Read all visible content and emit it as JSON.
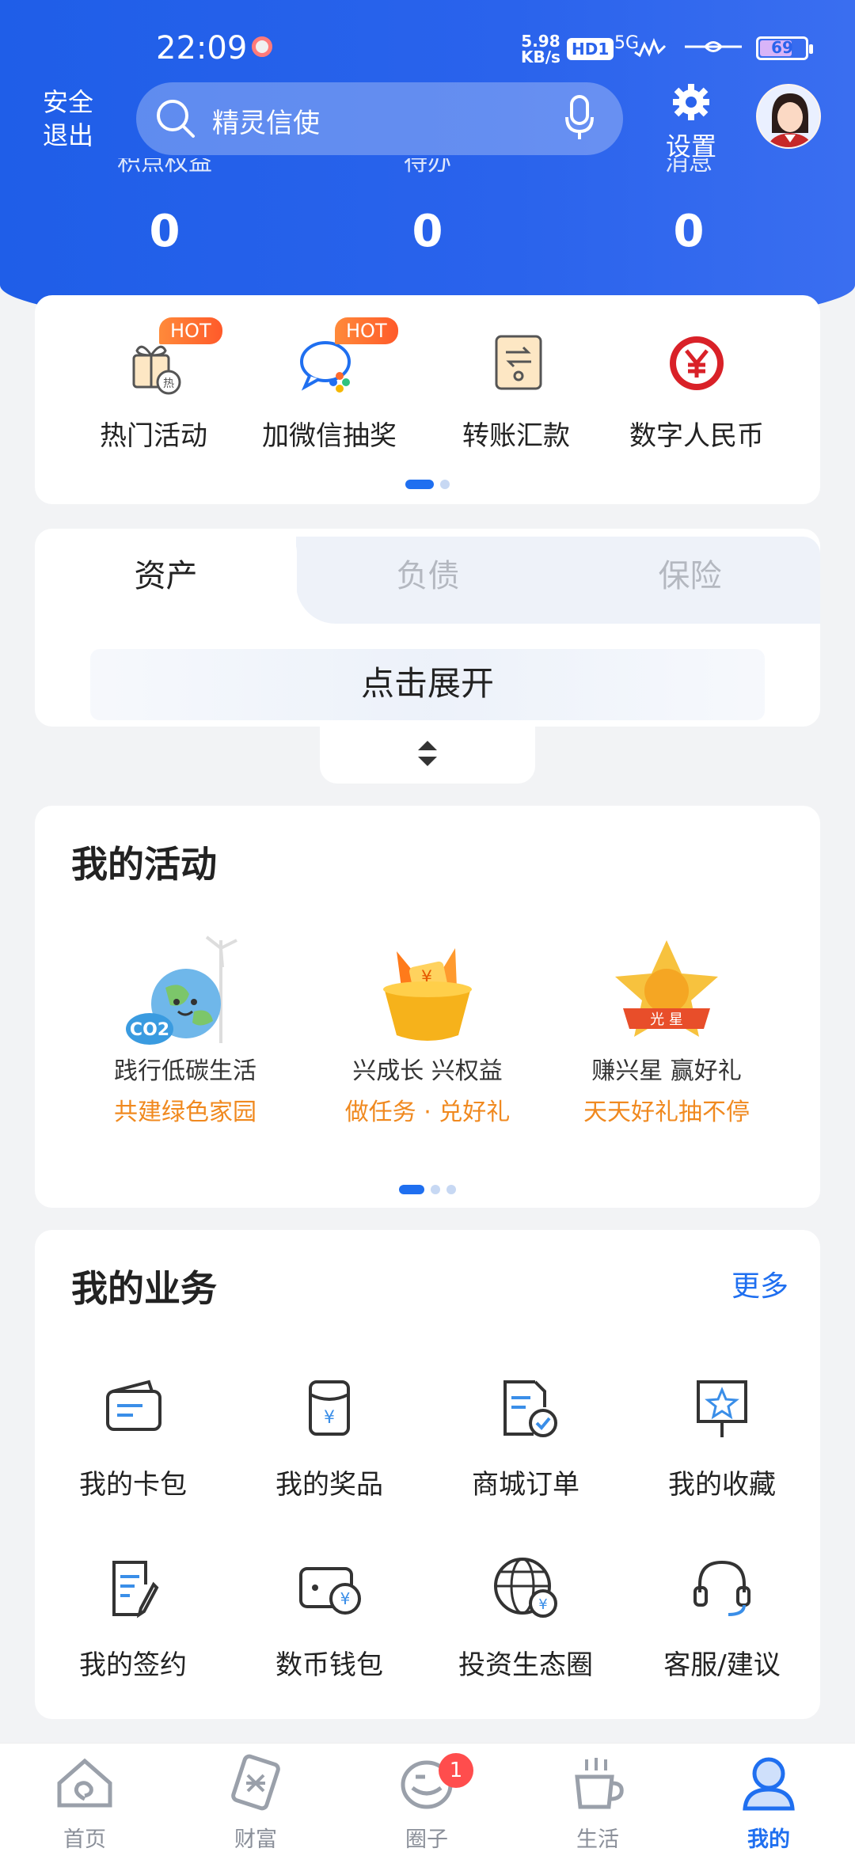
{
  "status_bar": {
    "time": "22:09",
    "net_speed": "5.98",
    "net_unit": "KB/s",
    "hd": "HD1",
    "signal": "5G",
    "battery": "69"
  },
  "header": {
    "logout_label": "安全\n退出",
    "search_placeholder": "精灵信使",
    "settings_label": "设置"
  },
  "stats": [
    {
      "title": "积点权益",
      "value": "0"
    },
    {
      "title": "待办",
      "value": "0"
    },
    {
      "title": "消息",
      "value": "0"
    }
  ],
  "quick_actions": [
    {
      "label": "热门活动",
      "badge": "HOT",
      "icon": "gift-icon"
    },
    {
      "label": "加微信抽奖",
      "badge": "HOT",
      "icon": "wechat-chat-icon"
    },
    {
      "label": "转账汇款",
      "icon": "transfer-icon"
    },
    {
      "label": "数字人民币",
      "icon": "digital-rmb-icon"
    }
  ],
  "asset_tabs": {
    "tabs": [
      "资产",
      "负债",
      "保险"
    ],
    "expand_label": "点击展开"
  },
  "activities": {
    "title": "我的活动",
    "items": [
      {
        "line1": "践行低碳生活",
        "line2": "共建绿色家园",
        "icon": "earth-co2-icon"
      },
      {
        "line1": "兴成长 兴权益",
        "line2": "做任务 · 兑好礼",
        "icon": "gift-box-icon"
      },
      {
        "line1": "赚兴星 赢好礼",
        "line2": "天天好礼抽不停",
        "icon": "star-badge-icon"
      }
    ]
  },
  "business": {
    "title": "我的业务",
    "more_label": "更多",
    "items": [
      {
        "label": "我的卡包",
        "icon": "card-wallet-icon"
      },
      {
        "label": "我的奖品",
        "icon": "prize-icon"
      },
      {
        "label": "商城订单",
        "icon": "order-icon"
      },
      {
        "label": "我的收藏",
        "icon": "favorite-icon"
      },
      {
        "label": "我的签约",
        "icon": "contract-icon"
      },
      {
        "label": "数币钱包",
        "icon": "coin-wallet-icon"
      },
      {
        "label": "投资生态圈",
        "icon": "globe-invest-icon"
      },
      {
        "label": "客服/建议",
        "icon": "headset-icon"
      }
    ]
  },
  "tabbar": {
    "items": [
      {
        "label": "首页",
        "icon": "home-icon"
      },
      {
        "label": "财富",
        "icon": "wealth-icon"
      },
      {
        "label": "圈子",
        "icon": "circle-icon",
        "badge": "1"
      },
      {
        "label": "生活",
        "icon": "coffee-icon"
      },
      {
        "label": "我的",
        "icon": "profile-icon",
        "active": true
      }
    ]
  },
  "colors": {
    "brand_blue": "#1f6ff0",
    "header_blue": "#2a63ec",
    "hot_orange": "#ff6a2e",
    "accent_orange": "#f0891f"
  }
}
